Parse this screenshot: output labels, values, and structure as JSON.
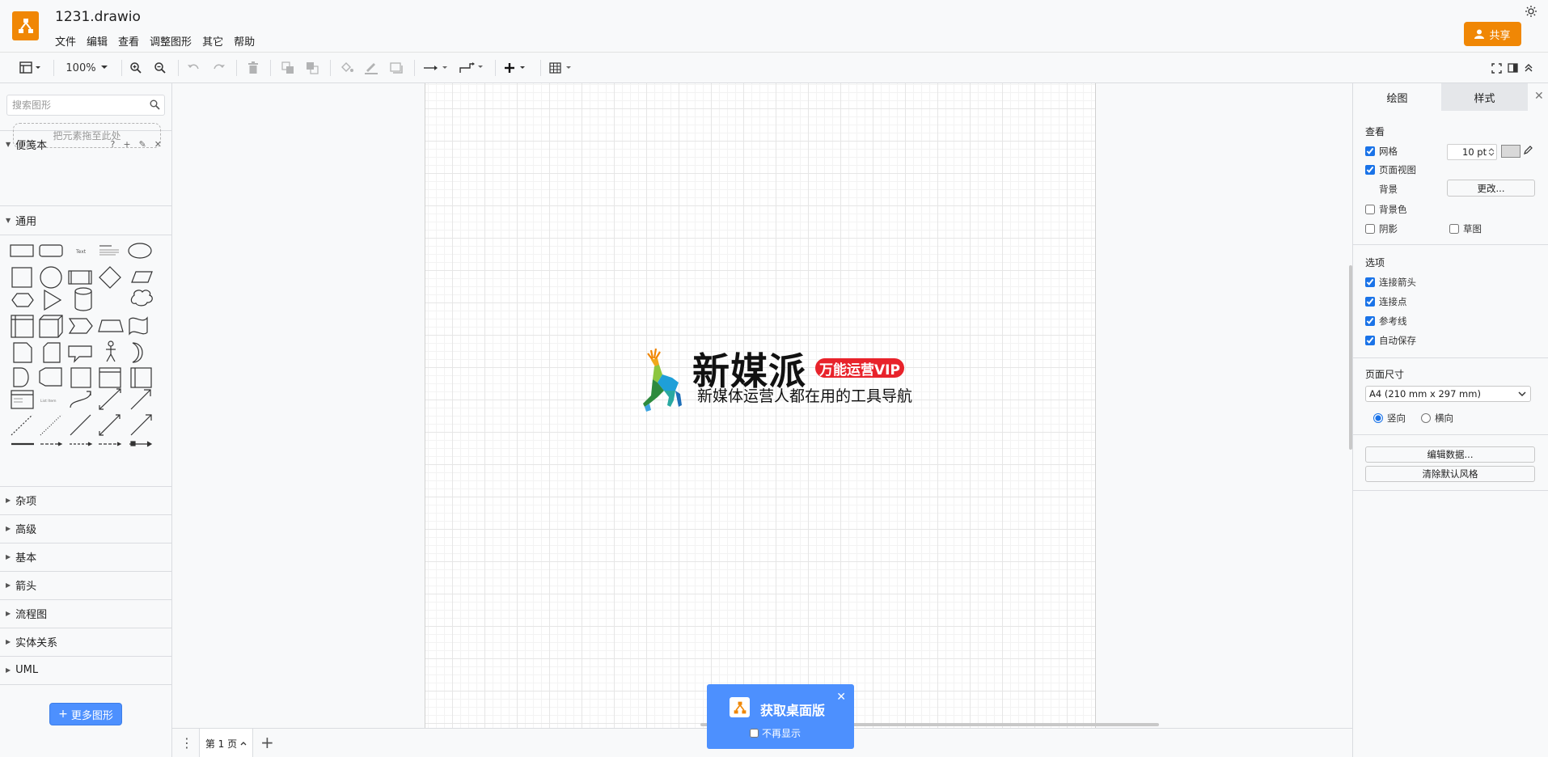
{
  "app": {
    "file_title": "1231.drawio",
    "menu": [
      "文件",
      "编辑",
      "查看",
      "调整图形",
      "其它",
      "帮助"
    ],
    "share_label": "共享"
  },
  "toolbar": {
    "zoom": "100%"
  },
  "sidebar": {
    "search_placeholder": "搜索图形",
    "scratchpad": {
      "title": "便笺本",
      "help": "?",
      "drop_text": "把元素拖至此处"
    },
    "general_title": "通用",
    "collapsed_sections": [
      "杂项",
      "高级",
      "基本",
      "箭头",
      "流程图",
      "实体关系",
      "UML"
    ],
    "more_shapes_label": "更多图形"
  },
  "canvas": {
    "brand_title": "新媒派",
    "brand_badge": "万能运营VIP",
    "brand_slogan": "新媒体运营人都在用的工具导航"
  },
  "page_tabs": {
    "current": "第 1 页"
  },
  "toast": {
    "title": "获取桌面版",
    "checkbox_label": "不再显示"
  },
  "right_panel": {
    "tabs": [
      "绘图",
      "样式"
    ],
    "view": {
      "title": "查看",
      "grid_label": "网格",
      "grid_checked": true,
      "grid_size": "10 pt",
      "page_view_label": "页面视图",
      "page_view_checked": true,
      "background_label": "背景",
      "background_button": "更改...",
      "bg_color_label": "背景色",
      "bg_color_checked": false,
      "shadow_label": "阴影",
      "shadow_checked": false,
      "sketch_label": "草图",
      "sketch_checked": false
    },
    "options": {
      "title": "选项",
      "items": [
        {
          "label": "连接箭头",
          "checked": true
        },
        {
          "label": "连接点",
          "checked": true
        },
        {
          "label": "参考线",
          "checked": true
        },
        {
          "label": "自动保存",
          "checked": true
        }
      ]
    },
    "page_size": {
      "title": "页面尺寸",
      "selected": "A4 (210 mm x 297 mm)",
      "portrait_label": "竖向",
      "landscape_label": "横向",
      "orientation": "portrait"
    },
    "edit_data_button": "编辑数据...",
    "clear_style_button": "清除默认风格"
  },
  "colors": {
    "accent_orange": "#f08705",
    "accent_blue": "#4d90fe",
    "badge_red": "#e8232b"
  }
}
